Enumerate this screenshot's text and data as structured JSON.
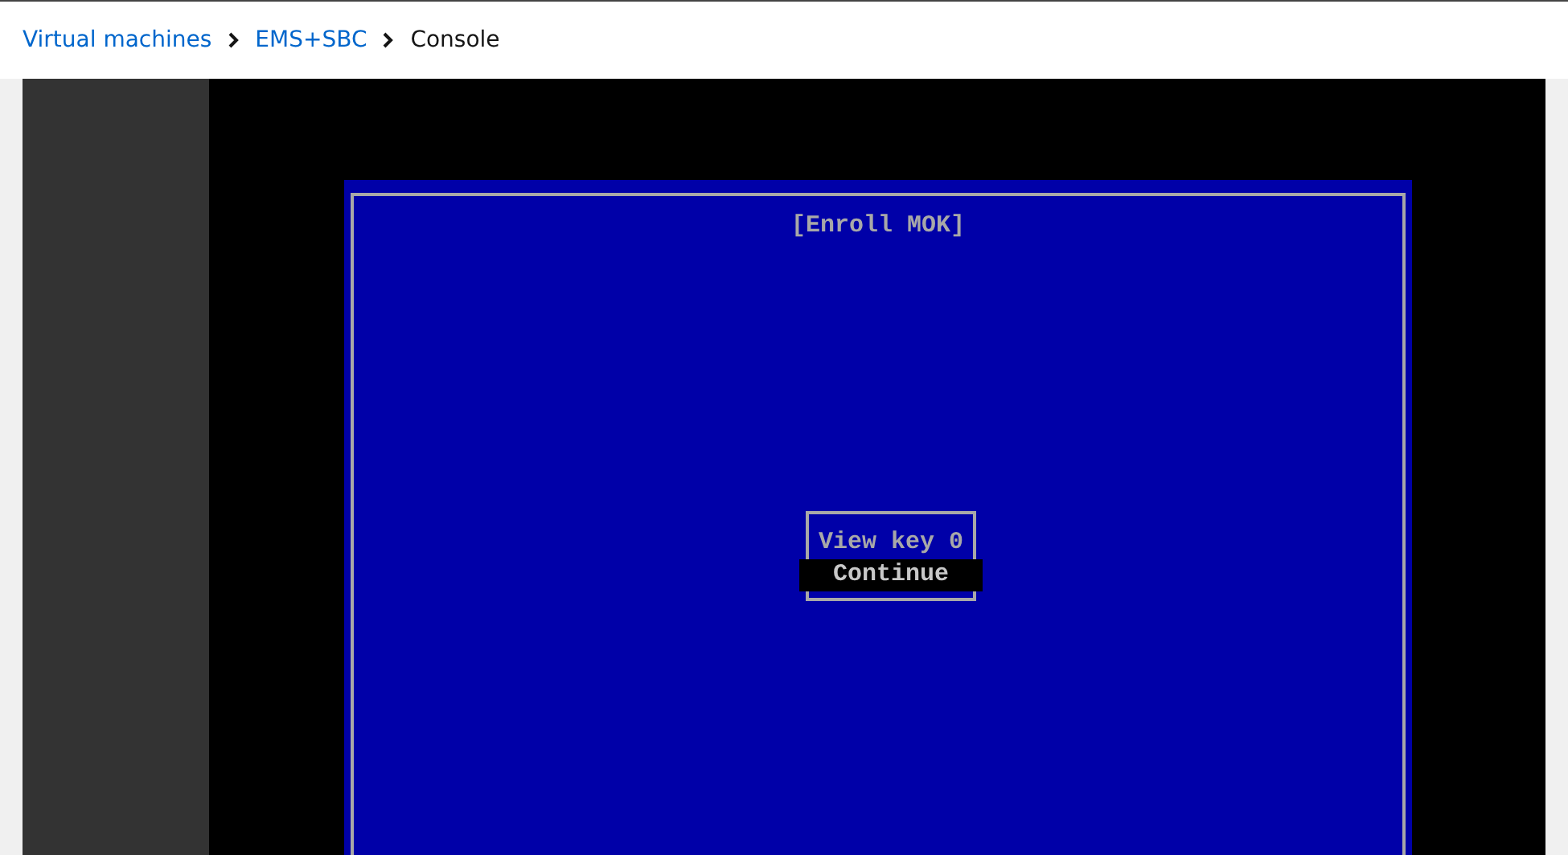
{
  "breadcrumb": [
    {
      "label": "Virtual machines",
      "kind": "link"
    },
    {
      "label": "EMS+SBC",
      "kind": "link"
    },
    {
      "label": "Console",
      "kind": "current"
    }
  ],
  "console": {
    "title": "[Enroll MOK]",
    "menu": [
      {
        "label": "View key 0",
        "selected": false
      },
      {
        "label": "Continue",
        "selected": true
      }
    ]
  }
}
